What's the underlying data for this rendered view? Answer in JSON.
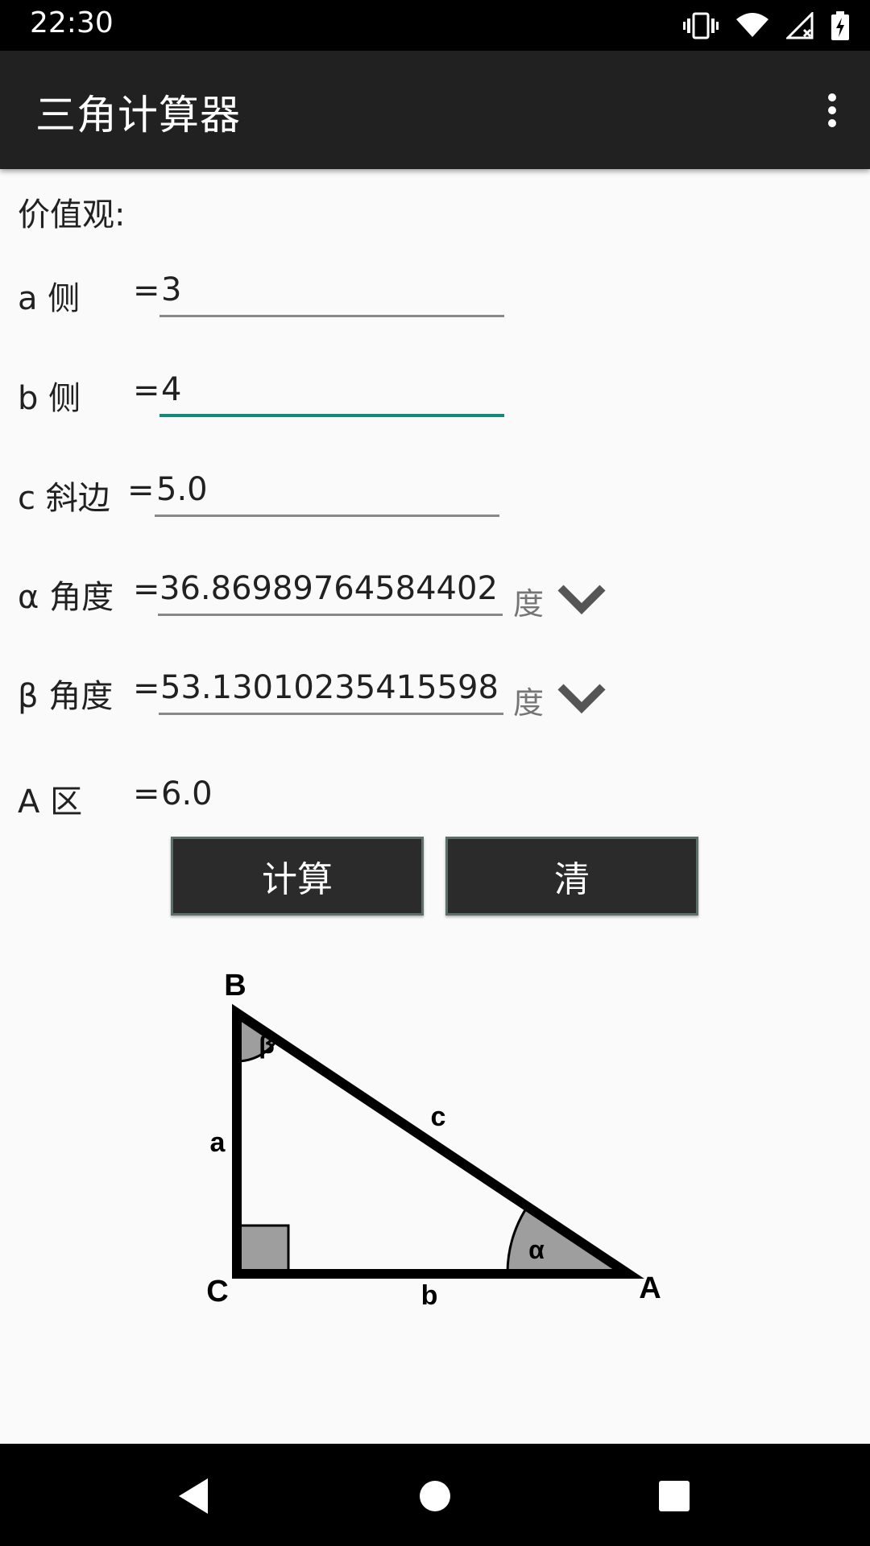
{
  "status_bar": {
    "time": "22:30",
    "icons": [
      "vibrate-icon",
      "wifi-icon",
      "signal-icon",
      "battery-charging-icon"
    ]
  },
  "app_bar": {
    "title": "三角计算器",
    "menu_icon": "overflow-menu-icon"
  },
  "form": {
    "section_label": "价值观:",
    "rows": [
      {
        "label": "a 侧",
        "eq": "=",
        "value": "3"
      },
      {
        "label": "b 侧",
        "eq": "=",
        "value": "4"
      },
      {
        "label": "c 斜边",
        "eq": "=",
        "value": "5.0"
      },
      {
        "label": "α 角度",
        "eq": "=",
        "value": "36.86989764584402",
        "unit": "度"
      },
      {
        "label": "β 角度",
        "eq": "=",
        "value": "53.13010235415598",
        "unit": "度"
      },
      {
        "label": "A 区",
        "eq": "=",
        "value": "6.0"
      }
    ]
  },
  "buttons": {
    "calculate": "计算",
    "clear": "清"
  },
  "diagram": {
    "vertex_b": "B",
    "vertex_c": "C",
    "vertex_a": "A",
    "side_a": "a",
    "side_b": "b",
    "side_c": "c",
    "angle_alpha": "α",
    "angle_beta": "β"
  },
  "nav_bar": {
    "back_icon": "back-icon",
    "home_icon": "home-icon",
    "recents_icon": "recents-icon"
  },
  "colors": {
    "app_bar": "#212121",
    "accent": "#138a7c",
    "button_bg": "#2b2b2b",
    "background": "#fafafa"
  }
}
